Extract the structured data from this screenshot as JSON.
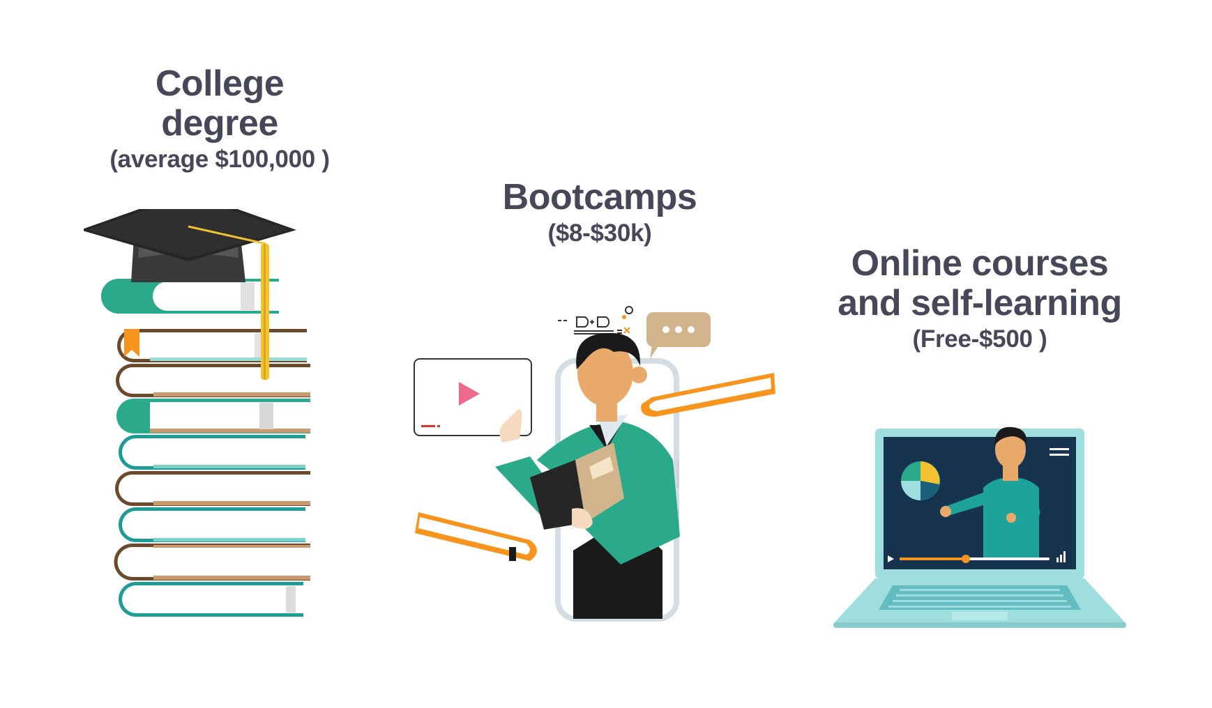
{
  "college": {
    "title_line1": "College",
    "title_line2": "degree",
    "price": "(average $100,000 )"
  },
  "bootcamps": {
    "title": "Bootcamps",
    "price": "($8-$30k)"
  },
  "online": {
    "title_line1": "Online courses",
    "title_line2": "and self-learning",
    "price": "(Free-$500 )"
  },
  "colors": {
    "heading": "#464758",
    "teal": "#2aa98b",
    "orange": "#f7941d",
    "navy": "#1c3557",
    "laptop": "#9fdede"
  },
  "icons": [
    "graduation-cap-icon",
    "book-stack-icon",
    "phone-tutor-icon",
    "video-play-icon",
    "chat-bubble-icon",
    "laptop-video-icon",
    "pie-chart-icon"
  ]
}
